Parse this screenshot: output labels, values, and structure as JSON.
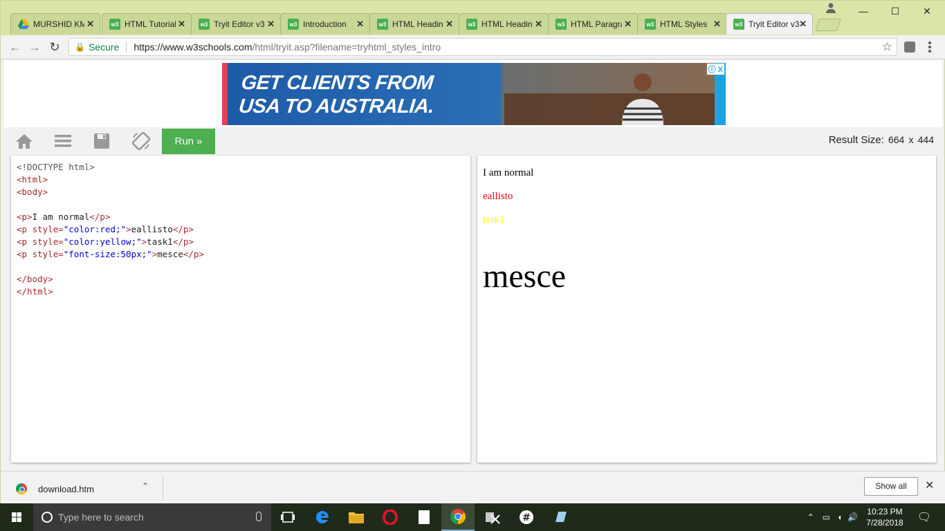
{
  "browser": {
    "tabs": [
      {
        "title": "MURSHID KM",
        "favicon": "drive-icon",
        "active": false
      },
      {
        "title": "HTML Tutorial",
        "favicon": "w3-icon",
        "active": false
      },
      {
        "title": "Tryit Editor v3",
        "favicon": "w3-icon",
        "active": false
      },
      {
        "title": "Introduction",
        "favicon": "w3-icon",
        "active": false
      },
      {
        "title": "HTML Headings",
        "favicon": "w3-icon",
        "active": false
      },
      {
        "title": "HTML Headings",
        "favicon": "w3-icon",
        "active": false
      },
      {
        "title": "HTML Paragraphs",
        "favicon": "w3-icon",
        "active": false
      },
      {
        "title": "HTML Styles",
        "favicon": "w3-icon",
        "active": false
      },
      {
        "title": "Tryit Editor v3",
        "favicon": "w3-icon",
        "active": true
      }
    ],
    "favicon_text": "w3",
    "secure_label": "Secure",
    "url_host": "https://www.w3schools.com",
    "url_path": "/html/tryit.asp?filename=tryhtml_styles_intro"
  },
  "ad": {
    "line1": "GET CLIENTS FROM",
    "line2": "USA TO AUSTRALIA.",
    "info": "ⓘ X"
  },
  "editor": {
    "run_label": "Run »",
    "result_size_label": "Result Size:",
    "result_width": "664",
    "result_x": "x",
    "result_height": "444",
    "code": {
      "doctype": "<!DOCTYPE html>",
      "html_open": "<html>",
      "body_open": "<body>",
      "p_open": "<p>",
      "p_close": "</p>",
      "p_style_open": "<p",
      "style_attr": "style=",
      "close_bracket": ">",
      "line1_text": "I am normal",
      "line2_val": "\"color:red;\"",
      "line2_text": "eallisto",
      "line3_val": "\"color:yellow;\"",
      "line3_text": "task1",
      "line4_val": "\"font-size:50px;\"",
      "line4_text": "mesce",
      "body_close": "</body>",
      "html_close": "</html>"
    },
    "result": [
      {
        "text": "I am normal",
        "color": "#000000"
      },
      {
        "text": "eallisto",
        "color": "#ff0000"
      },
      {
        "text": "task1",
        "color": "#ffff00"
      },
      {
        "text": "mesce",
        "color": "#000000"
      }
    ]
  },
  "downloads": {
    "file": "download.htm",
    "show_all": "Show all"
  },
  "taskbar": {
    "search_placeholder": "Type here to search",
    "time": "10:23 PM",
    "date": "7/28/2018"
  }
}
